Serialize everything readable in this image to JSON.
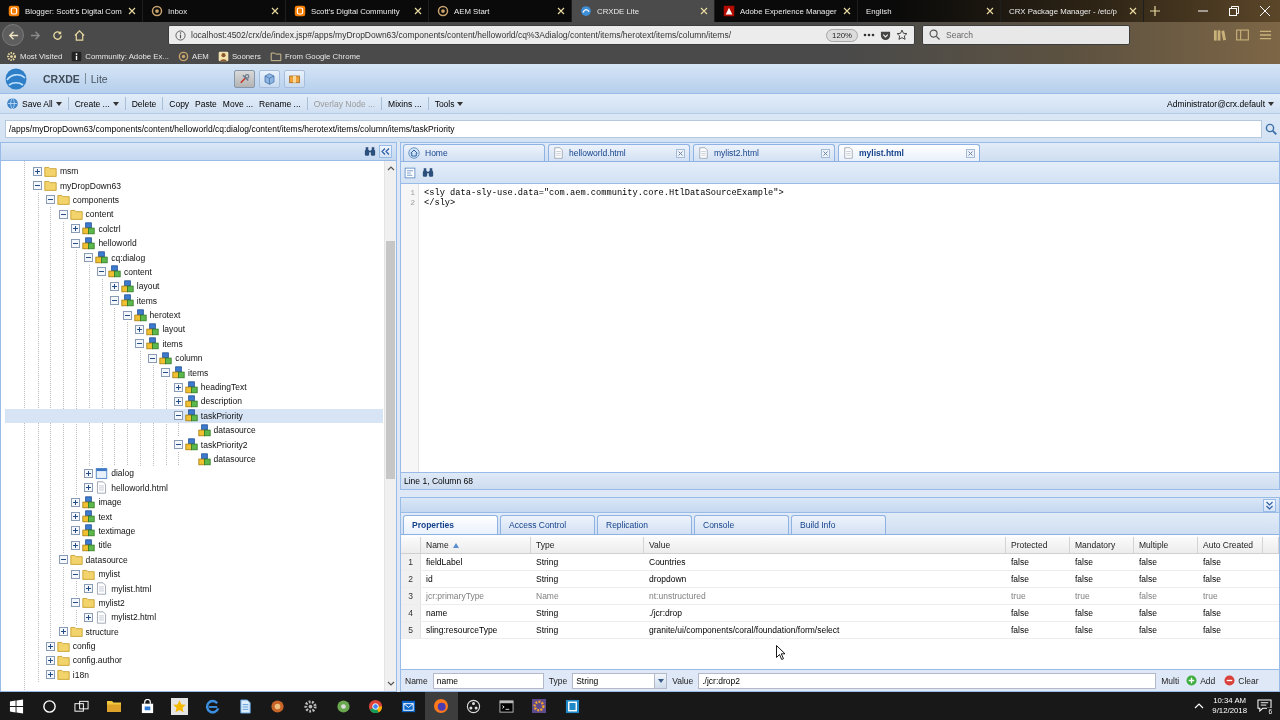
{
  "browser": {
    "tabs": [
      {
        "title": "Blogger: Scott's Digital Com",
        "selected": false
      },
      {
        "title": "Inbox",
        "selected": false
      },
      {
        "title": "Scott's Digital Community",
        "selected": false
      },
      {
        "title": "AEM Start",
        "selected": false
      },
      {
        "title": "CRXDE Lite",
        "selected": true
      },
      {
        "title": "Adobe Experience Manager",
        "selected": false
      },
      {
        "title": "English",
        "selected": false
      },
      {
        "title": "CRX Package Manager - /etc/p",
        "selected": false
      }
    ],
    "url": "localhost:4502/crx/de/index.jsp#/apps/myDropDown63/components/content/helloworld/cq%3Adialog/content/items/herotext/items/column/items/",
    "zoom": "120%",
    "search": {
      "placeholder": "Search"
    },
    "bookmarks": [
      {
        "label": "Most Visited"
      },
      {
        "label": "Community: Adobe Ex..."
      },
      {
        "label": "AEM"
      },
      {
        "label": "Sooners"
      },
      {
        "label": "From Google Chrome"
      }
    ]
  },
  "crxde": {
    "product": "CRXDE",
    "edition": "Lite",
    "mode_buttons": [
      {
        "selected": true
      },
      {
        "selected": false
      },
      {
        "selected": false
      }
    ],
    "toolbar": {
      "groups": [
        [
          {
            "label": "Save All",
            "kind": "menu",
            "disabled": false
          }
        ],
        [
          {
            "label": "Create ...",
            "kind": "menu",
            "disabled": false
          }
        ],
        [
          {
            "label": "Delete",
            "kind": "plain",
            "disabled": false
          }
        ],
        [
          {
            "label": "Copy",
            "kind": "plain",
            "disabled": false
          },
          {
            "label": "Paste",
            "kind": "plain",
            "disabled": false
          },
          {
            "label": "Move ...",
            "kind": "plain",
            "disabled": false
          },
          {
            "label": "Rename ...",
            "kind": "plain",
            "disabled": false
          }
        ],
        [
          {
            "label": "Overlay Node ...",
            "kind": "plain",
            "disabled": true
          }
        ],
        [
          {
            "label": "Mixins ...",
            "kind": "plain",
            "disabled": false
          }
        ],
        [
          {
            "label": "Tools",
            "kind": "menu",
            "disabled": false
          }
        ]
      ],
      "user": "Administrator@crx.default"
    },
    "path": "/apps/myDropDown63/components/content/helloworld/cq:dialog/content/items/herotext/items/column/items/taskPriority"
  },
  "tree": [
    {
      "label": "msm",
      "kind": "folder",
      "expanded": false,
      "selected": false
    },
    {
      "label": "myDropDown63",
      "kind": "folder",
      "expanded": true,
      "selected": false,
      "children": [
        {
          "label": "components",
          "kind": "folder",
          "expanded": true,
          "selected": false,
          "children": [
            {
              "label": "content",
              "kind": "folder",
              "expanded": true,
              "selected": false,
              "children": [
                {
                  "label": "colctrl",
                  "kind": "component",
                  "expanded": false,
                  "selected": false
                },
                {
                  "label": "helloworld",
                  "kind": "component",
                  "expanded": true,
                  "selected": false,
                  "children": [
                    {
                      "label": "cq:dialog",
                      "kind": "component",
                      "expanded": true,
                      "selected": false,
                      "children": [
                        {
                          "label": "content",
                          "kind": "component",
                          "expanded": true,
                          "selected": false,
                          "children": [
                            {
                              "label": "layout",
                              "kind": "component",
                              "expanded": false,
                              "selected": false
                            },
                            {
                              "label": "items",
                              "kind": "component",
                              "expanded": true,
                              "selected": false,
                              "children": [
                                {
                                  "label": "herotext",
                                  "kind": "component",
                                  "expanded": true,
                                  "selected": false,
                                  "children": [
                                    {
                                      "label": "layout",
                                      "kind": "component",
                                      "expanded": false,
                                      "selected": false
                                    },
                                    {
                                      "label": "items",
                                      "kind": "component",
                                      "expanded": true,
                                      "selected": false,
                                      "children": [
                                        {
                                          "label": "column",
                                          "kind": "component",
                                          "expanded": true,
                                          "selected": false,
                                          "children": [
                                            {
                                              "label": "items",
                                              "kind": "component",
                                              "expanded": true,
                                              "selected": false,
                                              "children": [
                                                {
                                                  "label": "headingText",
                                                  "kind": "component",
                                                  "expanded": false,
                                                  "selected": false
                                                },
                                                {
                                                  "label": "description",
                                                  "kind": "component",
                                                  "expanded": false,
                                                  "selected": false
                                                },
                                                {
                                                  "label": "taskPriority",
                                                  "kind": "component",
                                                  "expanded": true,
                                                  "selected": true,
                                                  "children": [
                                                    {
                                                      "label": "datasource",
                                                      "kind": "component",
                                                      "selected": false
                                                    }
                                                  ]
                                                },
                                                {
                                                  "label": "taskPriority2",
                                                  "kind": "component",
                                                  "expanded": true,
                                                  "selected": false,
                                                  "children": [
                                                    {
                                                      "label": "datasource",
                                                      "kind": "component",
                                                      "selected": false
                                                    }
                                                  ]
                                                }
                                              ]
                                            }
                                          ]
                                        }
                                      ]
                                    }
                                  ]
                                }
                              ]
                            }
                          ]
                        }
                      ]
                    },
                    {
                      "label": "dialog",
                      "kind": "dialog",
                      "expanded": false,
                      "selected": false
                    },
                    {
                      "label": "helloworld.html",
                      "kind": "file",
                      "expanded": false,
                      "selected": false
                    }
                  ]
                },
                {
                  "label": "image",
                  "kind": "component",
                  "expanded": false,
                  "selected": false
                },
                {
                  "label": "text",
                  "kind": "component",
                  "expanded": false,
                  "selected": false
                },
                {
                  "label": "textimage",
                  "kind": "component",
                  "expanded": false,
                  "selected": false
                },
                {
                  "label": "title",
                  "kind": "component",
                  "expanded": false,
                  "selected": false
                }
              ]
            },
            {
              "label": "datasource",
              "kind": "folder",
              "expanded": true,
              "selected": false,
              "children": [
                {
                  "label": "mylist",
                  "kind": "folder",
                  "expanded": true,
                  "selected": false,
                  "children": [
                    {
                      "label": "mylist.html",
                      "kind": "file",
                      "expanded": false,
                      "selected": false
                    }
                  ]
                },
                {
                  "label": "mylist2",
                  "kind": "folder",
                  "expanded": true,
                  "selected": false,
                  "children": [
                    {
                      "label": "mylist2.html",
                      "kind": "file",
                      "expanded": false,
                      "selected": false
                    }
                  ]
                }
              ]
            },
            {
              "label": "structure",
              "kind": "folder",
              "expanded": false,
              "selected": false
            }
          ]
        },
        {
          "label": "config",
          "kind": "folder",
          "expanded": false,
          "selected": false
        },
        {
          "label": "config.author",
          "kind": "folder",
          "expanded": false,
          "selected": false
        },
        {
          "label": "i18n",
          "kind": "folder",
          "expanded": false,
          "selected": false
        }
      ]
    }
  ],
  "editor": {
    "tabs": [
      {
        "title": "Home",
        "kind": "home",
        "selected": false
      },
      {
        "title": "helloworld.html",
        "kind": "file",
        "selected": false
      },
      {
        "title": "mylist2.html",
        "kind": "file",
        "selected": false
      },
      {
        "title": "mylist.html",
        "kind": "file",
        "selected": true
      }
    ],
    "lines": [
      {
        "number": "1",
        "text": "<sly data-sly-use.data=\"com.aem.community.core.HtlDataSourceExample\">"
      },
      {
        "number": "2",
        "text": "</sly>"
      }
    ],
    "status": "Line 1, Column 68"
  },
  "properties": {
    "tabs": [
      {
        "label": "Properties",
        "selected": true
      },
      {
        "label": "Access Control",
        "selected": false
      },
      {
        "label": "Replication",
        "selected": false
      },
      {
        "label": "Console",
        "selected": false
      },
      {
        "label": "Build Info",
        "selected": false
      }
    ],
    "columns": [
      {
        "label": "Name",
        "sorted": true
      },
      {
        "label": "Type",
        "sorted": false
      },
      {
        "label": "Value",
        "sorted": false
      },
      {
        "label": "Protected",
        "sorted": false
      },
      {
        "label": "Mandatory",
        "sorted": false
      },
      {
        "label": "Multiple",
        "sorted": false
      },
      {
        "label": "Auto Created",
        "sorted": false
      }
    ],
    "rows": [
      {
        "number": "1",
        "disabled": false,
        "cells": [
          "fieldLabel",
          "String",
          "Countries",
          "false",
          "false",
          "false",
          "false"
        ]
      },
      {
        "number": "2",
        "disabled": false,
        "cells": [
          "id",
          "String",
          "dropdown",
          "false",
          "false",
          "false",
          "false"
        ]
      },
      {
        "number": "3",
        "disabled": true,
        "cells": [
          "jcr:primaryType",
          "Name",
          "nt:unstructured",
          "true",
          "true",
          "false",
          "true"
        ]
      },
      {
        "number": "4",
        "disabled": false,
        "cells": [
          "name",
          "String",
          "./jcr:drop",
          "false",
          "false",
          "false",
          "false"
        ]
      },
      {
        "number": "5",
        "disabled": false,
        "cells": [
          "sling:resourceType",
          "String",
          "granite/ui/components/coral/foundation/form/select",
          "false",
          "false",
          "false",
          "false"
        ]
      }
    ],
    "form": {
      "name_label": "Name",
      "name": "name",
      "type_label": "Type",
      "type": "String",
      "value_label": "Value",
      "value": "./jcr:drop2",
      "multi_label": "Multi",
      "add": "Add",
      "clear": "Clear"
    }
  },
  "taskbar": {
    "apps": [
      {
        "selected": false
      },
      {
        "selected": false
      },
      {
        "selected": false
      },
      {
        "selected": false
      },
      {
        "selected": false
      },
      {
        "selected": false
      },
      {
        "selected": false
      },
      {
        "selected": false
      },
      {
        "selected": false
      },
      {
        "selected": false
      },
      {
        "selected": false
      },
      {
        "selected": false
      },
      {
        "selected": false
      },
      {
        "selected": true
      },
      {
        "selected": false
      },
      {
        "selected": false
      },
      {
        "selected": false
      },
      {
        "selected": false
      }
    ],
    "time": "10:34 AM",
    "date": "9/12/2018",
    "notifications": "6"
  }
}
